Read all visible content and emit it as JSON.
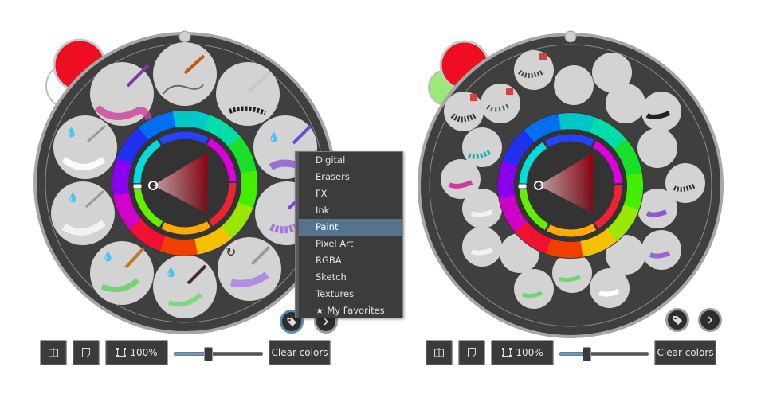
{
  "left_palette": {
    "toolbar": {
      "split_view_icon": "split-view-icon",
      "new_page_icon": "page-icon",
      "zoom_icon": "zoom-frame-icon",
      "zoom_label": "100%",
      "clear_label": "Clear colors",
      "slider_value": 0.38
    },
    "tag_button_icon": "tag-icon",
    "next_button_icon": "chevron-right-icon",
    "primary_color": "#ee0e22",
    "secondary_color": "#ffffff"
  },
  "tag_menu": {
    "items": [
      {
        "label": "Digital",
        "selected": false
      },
      {
        "label": "Erasers",
        "selected": false
      },
      {
        "label": "FX",
        "selected": false
      },
      {
        "label": "Ink",
        "selected": false
      },
      {
        "label": "Paint",
        "selected": true
      },
      {
        "label": "Pixel Art",
        "selected": false
      },
      {
        "label": "RGBA",
        "selected": false
      },
      {
        "label": "Sketch",
        "selected": false
      },
      {
        "label": "Textures",
        "selected": false
      },
      {
        "label": "My Favorites",
        "selected": false,
        "icon": "star-icon"
      }
    ]
  },
  "right_palette": {
    "toolbar": {
      "split_view_icon": "split-view-icon",
      "new_page_icon": "page-icon",
      "zoom_icon": "zoom-frame-icon",
      "zoom_label": "100%",
      "clear_label": "Clear colors",
      "slider_value": 0.3
    },
    "tag_button_icon": "tag-icon",
    "next_button_icon": "chevron-right-icon",
    "primary_color": "#ee0e22",
    "secondary_color": "#9ee879"
  },
  "colors": {
    "palette_bg": "#3f3f3f",
    "slot_bg": "#d3d3d3",
    "toolbar_bg": "#3b3b3b",
    "menu_highlight": "#547391",
    "accent": "#5d9ed1"
  }
}
